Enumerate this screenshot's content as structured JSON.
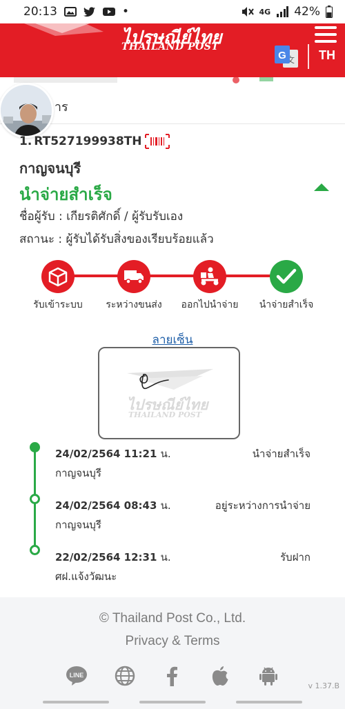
{
  "status_bar": {
    "time": "20:13",
    "dot": "•",
    "network": "4G",
    "battery": "42%",
    "icons": [
      "gallery-icon",
      "twitter-icon",
      "youtube-icon",
      "mute-icon",
      "signal-icon",
      "battery-icon"
    ]
  },
  "header": {
    "logo_thai": "ไปรษณีย์ไทย",
    "logo_en": "THAILAND POST",
    "language": "TH",
    "colors": {
      "brand_red": "#e31d25"
    }
  },
  "search": {
    "partial_text": "การ"
  },
  "parcel": {
    "number_prefix": "1.",
    "tracking_number": "RT527199938TH",
    "province": "กาญจนบุรี",
    "status": "นำจ่ายสำเร็จ",
    "recipient_label": "ชื่อผู้รับ :",
    "recipient_value": "เกียรติศักดิ์ / ผู้รับรับเอง",
    "state_label": "สถานะ :",
    "state_value": "ผู้รับได้รับสิ่งของเรียบร้อยแล้ว"
  },
  "progress_steps": [
    {
      "label": "รับเข้าระบบ",
      "icon": "box-icon",
      "color": "#e31d25"
    },
    {
      "label": "ระหว่างขนส่ง",
      "icon": "truck-icon",
      "color": "#e31d25"
    },
    {
      "label": "ออกไปนำจ่าย",
      "icon": "scooter-icon",
      "color": "#e31d25"
    },
    {
      "label": "นำจ่ายสำเร็จ",
      "icon": "check-icon",
      "color": "#2aa946"
    }
  ],
  "signature": {
    "link_label": "ลายเซ็น",
    "watermark_thai": "ไปรษณีย์ไทย",
    "watermark_en": "THAILAND POST"
  },
  "timeline": [
    {
      "date": "24/02/2564 11:21",
      "unit": "น.",
      "status": "นำจ่ายสำเร็จ",
      "place": "กาญจนบุรี",
      "filled": true
    },
    {
      "date": "24/02/2564 08:43",
      "unit": "น.",
      "status": "อยู่ระหว่างการนำจ่าย",
      "place": "กาญจนบุรี",
      "filled": false
    },
    {
      "date": "22/02/2564 12:31",
      "unit": "น.",
      "status": "รับฝาก",
      "place": "ศฝ.แจ้งวัฒนะ",
      "filled": false
    }
  ],
  "footer": {
    "copyright": "© Thailand Post Co., Ltd.",
    "terms": "Privacy & Terms",
    "version": "v 1.37.B",
    "social_icons": [
      "line-icon",
      "globe-icon",
      "facebook-icon",
      "apple-icon",
      "android-icon"
    ],
    "line_label": "LINE"
  }
}
